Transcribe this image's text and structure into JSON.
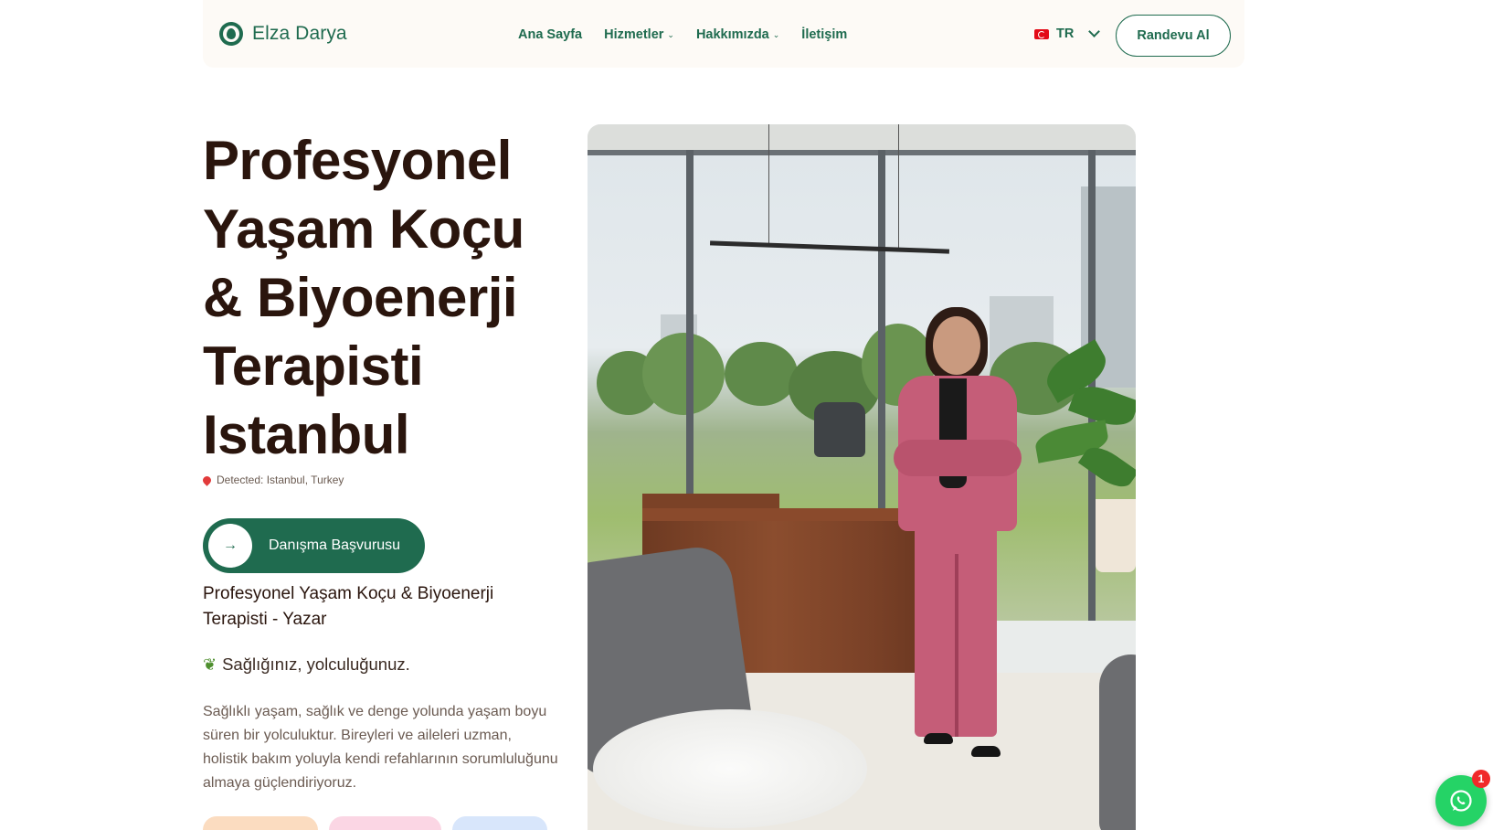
{
  "header": {
    "brand": "Elza Darya",
    "nav": [
      {
        "label": "Ana Sayfa",
        "dropdown": false
      },
      {
        "label": "Hizmetler",
        "dropdown": true
      },
      {
        "label": "Hakkımızda",
        "dropdown": true
      },
      {
        "label": "İletişim",
        "dropdown": false
      }
    ],
    "language": {
      "code": "TR",
      "flag_icon": "turkey-flag-icon"
    },
    "cta_label": "Randevu Al"
  },
  "hero": {
    "title_lines": [
      "Profesyonel",
      "Yaşam Koçu",
      "& Biyoenerji",
      "Terapisti",
      "Istanbul"
    ],
    "location_text": "Detected: Istanbul, Turkey",
    "consult_button": "Danışma Başvurusu",
    "subtitle": "Profesyonel Yaşam Koçu & Biyoenerji Terapisti - Yazar",
    "tagline": "Sağlığınız, yolculuğunuz.",
    "description": "Sağlıklı yaşam, sağlık ve denge yolunda yaşam boyu süren bir yolculuktur. Bireyleri ve aileleri uzman, holistik bakım yoluyla kendi refahlarının sorumluluğunu almaya güçlendiriyoruz."
  },
  "whatsapp": {
    "badge_count": "1"
  },
  "colors": {
    "brand_green": "#1f6b4f",
    "heading": "#2a150d",
    "header_bg": "#fdfaf6",
    "whatsapp": "#25d366",
    "pill_peach": "#fbdcc0",
    "pill_pink": "#fbd6e4",
    "pill_blue": "#d8e6fb"
  }
}
